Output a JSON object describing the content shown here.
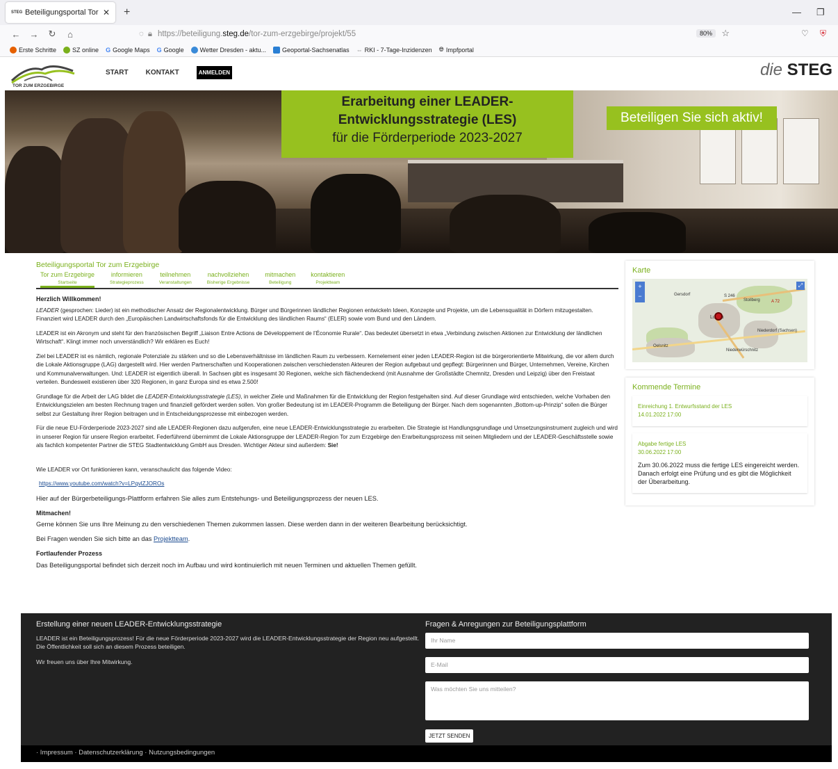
{
  "browser": {
    "tab_title": "Beteiligungsportal Tor zum Erzg",
    "url_prefix": "https://beteiligung.",
    "url_domain": "steg.de",
    "url_path": "/tor-zum-erzgebirge/projekt/55",
    "zoom": "80%",
    "bookmarks": [
      "Erste Schritte",
      "SZ online",
      "Google Maps",
      "Google",
      "Wetter Dresden - aktu...",
      "Geoportal-Sachsenatlas",
      "RKI - 7-Tage-Inzidenzen",
      "Impfportal"
    ]
  },
  "header": {
    "logo_text": "TOR ZUM ERZGEBIRGE",
    "nav": [
      "START",
      "KONTAKT"
    ],
    "login": "ANMELDEN",
    "brand_die": "die",
    "brand_steg": "STEG"
  },
  "hero": {
    "line1": "Erarbeitung einer LEADER-",
    "line2": "Entwicklungsstrategie (LES)",
    "line3": "für die Förderperiode 2023-2027",
    "cta": "Beteiligen Sie sich aktiv!"
  },
  "portal": {
    "title": "Beteiligungsportal Tor zum Erzgebirge",
    "tabs": [
      {
        "a": "Tor zum Erzgebirge",
        "b": "Startseite"
      },
      {
        "a": "informieren",
        "b": "Strategieprozess"
      },
      {
        "a": "teilnehmen",
        "b": "Veranstaltungen"
      },
      {
        "a": "nachvollziehen",
        "b": "Bisherige Ergebnisse"
      },
      {
        "a": "mitmachen",
        "b": "Beteiligung"
      },
      {
        "a": "kontaktieren",
        "b": "Projektteam"
      }
    ]
  },
  "content": {
    "welcome": "Herzlich Willkommen!",
    "p1_em": "LEADER",
    "p1": " (gesprochen: Lieder) ist ein methodischer Ansatz der Regionalentwicklung. Bürger und Bürgerinnen ländlicher Regionen entwickeln Ideen, Konzepte und Projekte, um die Lebensqualität in Dörfern mitzugestalten. Finanziert wird LEADER durch den „Europäischen Landwirtschaftsfonds für die Entwicklung des ländlichen Raums“ (ELER) sowie vom Bund und den Ländern.",
    "p2": "LEADER ist ein Akronym und steht für den französischen Begriff „Liaison Entre Actions de Développement de l’Économie Rurale“. Das bedeutet übersetzt in etwa „Verbindung zwischen Aktionen zur Entwicklung der ländlichen Wirtschaft“. Klingt immer noch unverständlich? Wir erklären es Euch!",
    "p3": "Ziel bei LEADER ist es nämlich, regionale Potenziale zu stärken und so die Lebensverhältnisse im ländlichen Raum zu verbessern. Kernelement einer jeden LEADER-Region ist die bürgerorientierte Mitwirkung, die vor allem durch die Lokale Aktionsgruppe (LAG) dargestellt wird. Hier werden Partnerschaften und Kooperationen zwischen verschiedensten Akteuren der Region aufgebaut und gepflegt: Bürgerinnen und Bürger, Unternehmen, Vereine, Kirchen und Kommunalverwaltungen. Und: LEADER ist eigentlich überall. In Sachsen gibt es insgesamt 30 Regionen, welche sich flächendeckend (mit Ausnahme der Großstädte Chemnitz, Dresden und Leipzig) über den Freistaat verteilen. Bundesweit existieren über 320 Regionen, in ganz Europa sind es etwa 2.500!",
    "p4a": "Grundlage für die Arbeit der LAG bildet die ",
    "p4em": "LEADER-Entwicklungsstrategie (LES)",
    "p4b": ", in welcher Ziele und Maßnahmen für die Entwicklung der Region festgehalten sind. Auf dieser Grundlage wird entschieden, welche Vorhaben den Entwicklungszielen am besten Rechnung tragen und finanziell gefördert werden sollen. Von großer Bedeutung ist im LEADER-Programm die Beteiligung der Bürger. Nach dem sogenannten „Bottom-up-Prinzip“ sollen die Bürger selbst zur Gestaltung ihrer Region beitragen und in Entscheidungsprozesse mit einbezogen werden.",
    "p5": "Für die neue EU-Förderperiode 2023-2027 sind alle LEADER-Regionen dazu aufgerufen, eine neue LEADER-Entwicklungsstrategie zu erarbeiten. Die Strategie ist Handlungsgrundlage und Umsetzungsinstrument zugleich und wird in unserer Region für unsere Region erarbeitet. Federführend übernimmt die Lokale Aktionsgruppe der LEADER-Region Tor zum Erzgebirge den Erarbeitungsprozess mit seinen Mitgliedern und der LEADER-Geschäftsstelle sowie als fachlich kompetenter Partner die STEG Stadtentwicklung GmbH aus Dresden. Wichtiger Akteur sind außerdem: ",
    "p5b": "Sie!",
    "video_intro": "Wie LEADER vor Ort funktionieren kann, veranschaulicht das folgende Video:",
    "video_link": "https://www.youtube.com/watch?v=LPqvlZJOROs",
    "p6": "Hier auf der Bürgerbeteiligungs-Plattform erfahren Sie alles zum Entstehungs- und Beteiligungsprozess der neuen LES.",
    "h_mit": "Mitmachen!",
    "p7": "Gerne können Sie uns Ihre Meinung zu den verschiedenen Themen zukommen lassen. Diese werden dann in der weiteren Bearbeitung berücksichtigt.",
    "p8a": "Bei Fragen wenden Sie sich bitte an das ",
    "p8link": "Projektteam",
    "p8b": ".",
    "h_fort": "Fortlaufender Prozess",
    "p9": "Das Beteiligungsportal befindet sich derzeit noch im Aufbau und wird kontinuierlich mit neuen Terminen und aktuellen Themen gefüllt."
  },
  "sidebar": {
    "map_title": "Karte",
    "map_labels": [
      "Gersdorf",
      "S 246",
      "Lugau",
      "Oelsnitz",
      "Niederdorf (Sachsen)",
      "Niederwürschnitz",
      "A 72",
      "Stollberg"
    ],
    "events_title": "Kommende Termine",
    "events": [
      {
        "title": "Einreichung 1. Entwurfsstand der LES",
        "date": "14.01.2022 17:00",
        "desc": ""
      },
      {
        "title": "Abgabe fertige LES",
        "date": "30.06.2022 17:00",
        "desc": "Zum 30.06.2022 muss die fertige LES eingereicht werden. Danach erfolgt eine Prüfung und es gibt die Möglichkeit der Überarbeitung."
      }
    ]
  },
  "footer": {
    "left_title": "Erstellung einer neuen LEADER-Entwicklungsstrategie",
    "left_p1": "LEADER ist ein Beteiligungsprozess! Für die neue Förderperiode 2023-2027 wird die LEADER-Entwicklungsstrategie der Region neu aufgestellt. Die Öffentlichkeit soll sich an diesem Prozess beteiligen.",
    "left_p2": "Wir freuen uns über Ihre Mitwirkung.",
    "right_title": "Fragen & Anregungen zur Beteiligungsplattform",
    "name_ph": "Ihr Name",
    "mail_ph": "E-Mail",
    "msg_ph": "Was möchten Sie uns mitteilen?",
    "send": "JETZT SENDEN",
    "bottom": "· Impressum · Datenschutzerklärung · Nutzungsbedingungen"
  }
}
